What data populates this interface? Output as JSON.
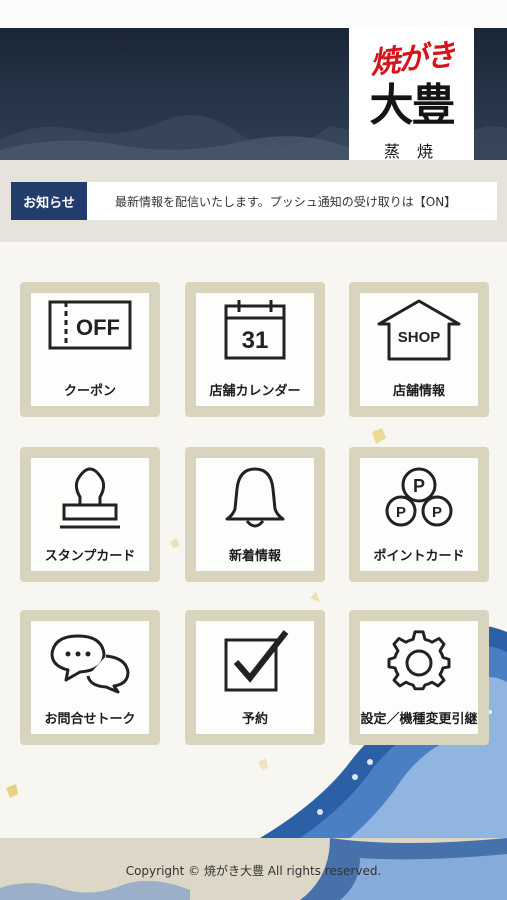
{
  "header": {
    "logo_top": "焼がき",
    "logo_main": "大豊",
    "logo_sub": "蒸 焼"
  },
  "news": {
    "label": "お知らせ",
    "text": "最新情報を配信いたします。プッシュ通知の受け取りは【ON】"
  },
  "menu": {
    "items": [
      {
        "label": "クーポン",
        "icon": "coupon-off-icon",
        "icon_text": "OFF"
      },
      {
        "label": "店舗カレンダー",
        "icon": "calendar-icon",
        "icon_text": "31"
      },
      {
        "label": "店舗情報",
        "icon": "shop-icon",
        "icon_text": "SHOP"
      },
      {
        "label": "スタンプカード",
        "icon": "stamp-icon"
      },
      {
        "label": "新着情報",
        "icon": "bell-icon"
      },
      {
        "label": "ポイントカード",
        "icon": "points-icon",
        "icon_text": "P"
      },
      {
        "label": "お問合せトーク",
        "icon": "chat-bubbles-icon"
      },
      {
        "label": "予約",
        "icon": "checkbox-icon"
      },
      {
        "label": "設定／機種変更引継",
        "icon": "gear-icon"
      }
    ]
  },
  "footer": {
    "copyright": "Copyright © 焼がき大豊 All rights reserved."
  },
  "colors": {
    "news_label_bg": "#223c6b",
    "tile_frame": "#d9d4bd",
    "logo_red": "#d8141b"
  }
}
